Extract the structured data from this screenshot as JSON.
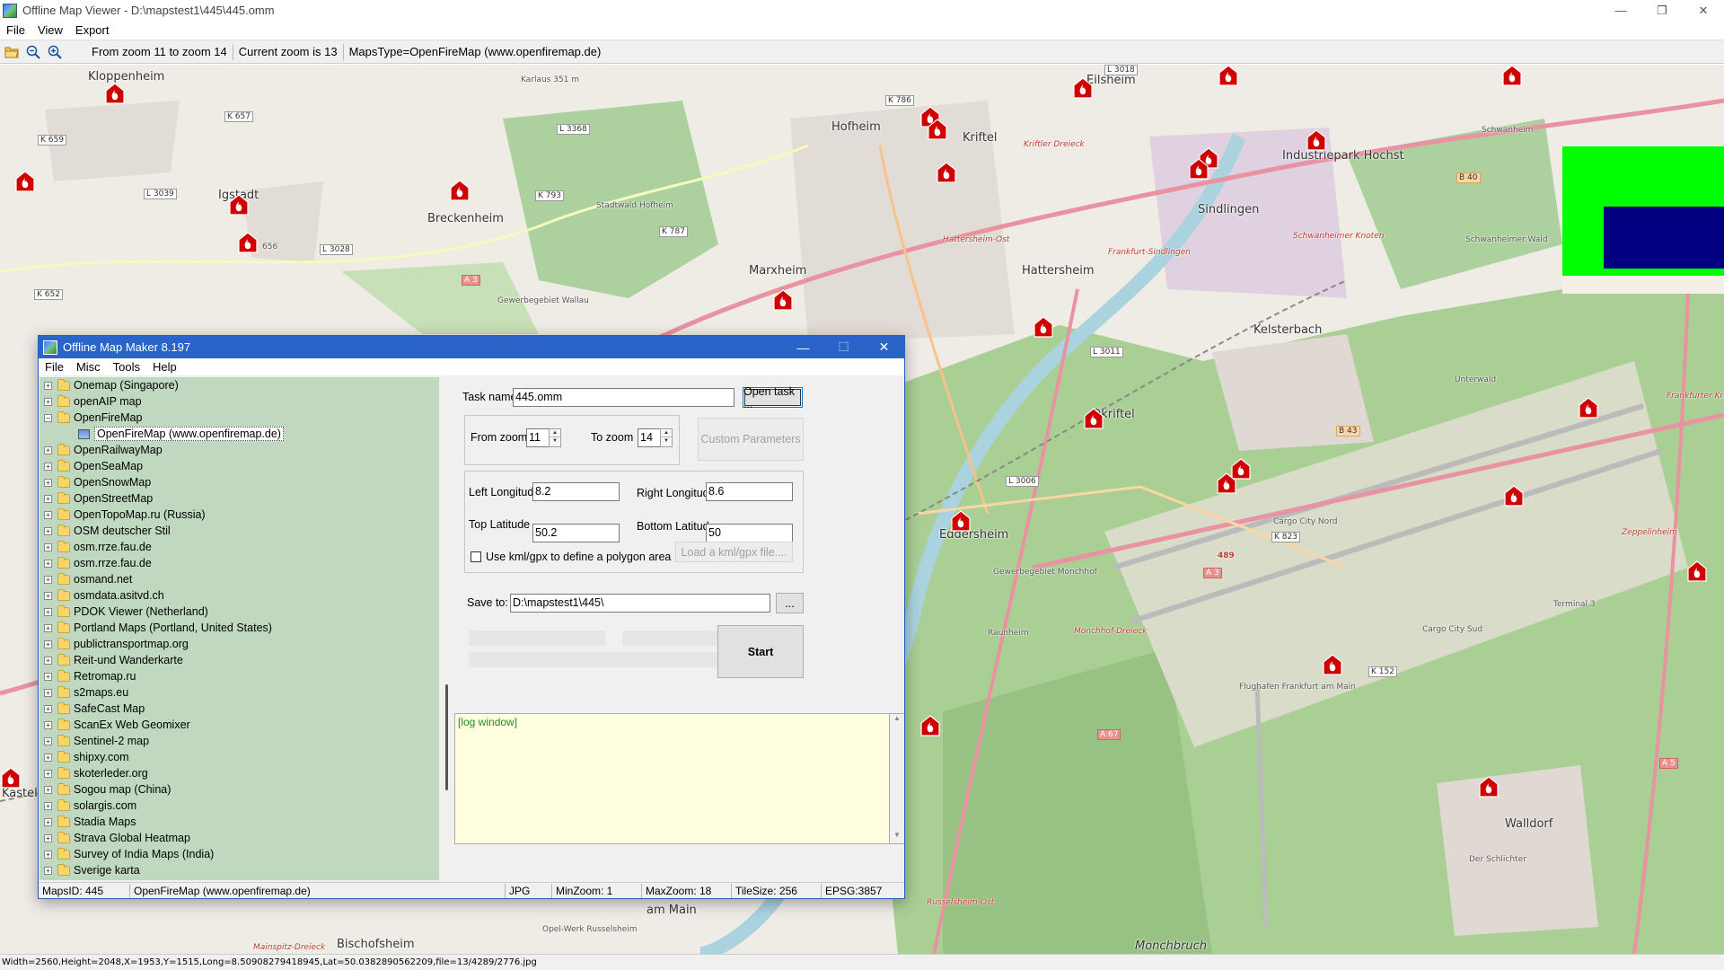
{
  "window": {
    "title": "Offline Map Viewer - D:\\mapstest1\\445\\445.omm",
    "controls": [
      "—",
      "❐",
      "✕"
    ]
  },
  "menu": [
    "File",
    "View",
    "Export"
  ],
  "toolbar": {
    "zoom_range": "From zoom 11 to zoom 14",
    "current_zoom": "Current zoom is 13",
    "maps_type": "MapsType=OpenFireMap (www.openfiremap.de)"
  },
  "map": {
    "places": [
      {
        "name": "Kloppenheim",
        "cls": "big"
      },
      {
        "name": "Igstadt",
        "cls": "big"
      },
      {
        "name": "Breckenheim",
        "cls": "big"
      },
      {
        "name": "Hofheim",
        "cls": "big"
      },
      {
        "name": "Kriftel",
        "cls": "big"
      },
      {
        "name": "Marxheim",
        "cls": "big"
      },
      {
        "name": "Hattersheim",
        "cls": "big"
      },
      {
        "name": "Sindlingen",
        "cls": "big"
      },
      {
        "name": "Kelsterbach",
        "cls": "big"
      },
      {
        "name": "Okriftel",
        "cls": "big"
      },
      {
        "name": "Eddersheim",
        "cls": "big"
      },
      {
        "name": "Walldorf",
        "cls": "big"
      },
      {
        "name": "Bischofsheim",
        "cls": "big"
      },
      {
        "name": "Eilsheim",
        "cls": "big"
      },
      {
        "name": "Industriepark Hochst",
        "cls": "big"
      },
      {
        "name": "Stadtwald Hofheim",
        "cls": "small"
      },
      {
        "name": "Schwanheimer Wald",
        "cls": "small"
      },
      {
        "name": "Unterwald",
        "cls": "small"
      },
      {
        "name": "Cargo City Nord",
        "cls": "small"
      },
      {
        "name": "Cargo City Sud",
        "cls": "small"
      },
      {
        "name": "Terminal 3",
        "cls": "small"
      },
      {
        "name": "Flughafen Frankfurt am Main",
        "cls": "small"
      },
      {
        "name": "Der Schlichter",
        "cls": "small"
      },
      {
        "name": "Monchbruch",
        "cls": "big"
      },
      {
        "name": "Opel-Werk Russelsheim",
        "cls": "small"
      },
      {
        "name": "am Main",
        "cls": "big"
      },
      {
        "name": "Gewerbegebiet Wallau",
        "cls": "small"
      },
      {
        "name": "Gewerbegebiet Monchhof",
        "cls": "small"
      },
      {
        "name": "Raunheim",
        "cls": "small"
      },
      {
        "name": "Kriftler Dreieck",
        "cls": "road"
      },
      {
        "name": "Schwanheimer Knoten",
        "cls": "road"
      },
      {
        "name": "Frankfurt-Sindlingen",
        "cls": "road"
      },
      {
        "name": "Hattersheim-Ost",
        "cls": "road"
      },
      {
        "name": "Monchhof-Dreieck",
        "cls": "road"
      },
      {
        "name": "Frankfurter Kreuz",
        "cls": "road"
      },
      {
        "name": "Zeppelinheim",
        "cls": "road"
      },
      {
        "name": "Mainspitz-Dreieck",
        "cls": "road"
      },
      {
        "name": "Russelsheim-Ost",
        "cls": "road"
      },
      {
        "name": "Karlaus 351 m",
        "cls": "small"
      },
      {
        "name": "Schwanheim",
        "cls": "small"
      },
      {
        "name": "Kastel",
        "cls": "big"
      }
    ],
    "shields": [
      "K 657",
      "K 659",
      "L 3039",
      "K 793",
      "L 3368",
      "L 3028",
      "K 652",
      "K 787",
      "K 786",
      "L 3018",
      "A 3",
      "L 3011",
      "L 3006",
      "B 43",
      "K 823",
      "A 3",
      "K 152",
      "A 67",
      "A 5",
      "B 40",
      "656",
      "489"
    ],
    "fire_count": 27
  },
  "overlay": {
    "green": "#00ff00",
    "navy": "#000080"
  },
  "status_bar": "Width=2560,Height=2048,X=1953,Y=1515,Long=8.50908279418945,Lat=50.0382890562209,file=13/4289/2776.jpg",
  "dialog": {
    "title": "Offline Map Maker 8.197",
    "menu": [
      "File",
      "Misc",
      "Tools",
      "Help"
    ],
    "tree": [
      {
        "label": "Onemap (Singapore)",
        "state": "+"
      },
      {
        "label": "openAIP map",
        "state": "+"
      },
      {
        "label": "OpenFireMap",
        "state": "-"
      },
      {
        "label": "OpenFireMap (www.openfiremap.de)",
        "state": "child"
      },
      {
        "label": "OpenRailwayMap",
        "state": "+"
      },
      {
        "label": "OpenSeaMap",
        "state": "+"
      },
      {
        "label": "OpenSnowMap",
        "state": "+"
      },
      {
        "label": "OpenStreetMap",
        "state": "+"
      },
      {
        "label": "OpenTopoMap.ru (Russia)",
        "state": "+"
      },
      {
        "label": "OSM deutscher Stil",
        "state": "+"
      },
      {
        "label": "osm.rrze.fau.de",
        "state": "+"
      },
      {
        "label": "osm.rrze.fau.de",
        "state": "+"
      },
      {
        "label": "osmand.net",
        "state": "+"
      },
      {
        "label": "osmdata.asitvd.ch",
        "state": "+"
      },
      {
        "label": "PDOK Viewer (Netherland)",
        "state": "+"
      },
      {
        "label": "Portland Maps (Portland, United States)",
        "state": "+"
      },
      {
        "label": "publictransportmap.org",
        "state": "+"
      },
      {
        "label": "Reit-und Wanderkarte",
        "state": "+"
      },
      {
        "label": "Retromap.ru",
        "state": "+"
      },
      {
        "label": "s2maps.eu",
        "state": "+"
      },
      {
        "label": "SafeCast Map",
        "state": "+"
      },
      {
        "label": "ScanEx Web Geomixer",
        "state": "+"
      },
      {
        "label": "Sentinel-2 map",
        "state": "+"
      },
      {
        "label": "shipxy.com",
        "state": "+"
      },
      {
        "label": "skoterleder.org",
        "state": "+"
      },
      {
        "label": "Sogou map (China)",
        "state": "+"
      },
      {
        "label": "solargis.com",
        "state": "+"
      },
      {
        "label": "Stadia Maps",
        "state": "+"
      },
      {
        "label": "Strava Global Heatmap",
        "state": "+"
      },
      {
        "label": "Survey of India Maps (India)",
        "state": "+"
      },
      {
        "label": "Sverige karta",
        "state": "+"
      }
    ],
    "task_name_label": "Task name",
    "task_name_value": "445.omm",
    "open_task_label": "Open task ...",
    "from_zoom_label": "From zoom",
    "from_zoom_value": "11",
    "to_zoom_label": "To zoom",
    "to_zoom_value": "14",
    "custom_params_label": "Custom Parameters",
    "left_lon_label": "Left Longitude",
    "left_lon_value": "8.2",
    "right_lon_label": "Right Longitude",
    "right_lon_value": "8.6",
    "top_lat_label": "Top Latitude",
    "top_lat_value": "50.2",
    "bottom_lat_label": "Bottom Latitude",
    "bottom_lat_value": "50",
    "kml_checkbox_label": "Use kml/gpx to define a polygon area",
    "load_kml_label": "Load a kml/gpx file....",
    "save_to_label": "Save to:",
    "save_to_value": "D:\\mapstest1\\445\\",
    "browse_label": "...",
    "start_label": "Start",
    "log_text": "[log window]",
    "status": {
      "maps_id": "MapsID: 445",
      "maps_name": "OpenFireMap (www.openfiremap.de)",
      "format": "JPG",
      "min_zoom": "MinZoom: 1",
      "max_zoom": "MaxZoom: 18",
      "tile_size": "TileSize: 256",
      "epsg": "EPSG:3857"
    }
  }
}
